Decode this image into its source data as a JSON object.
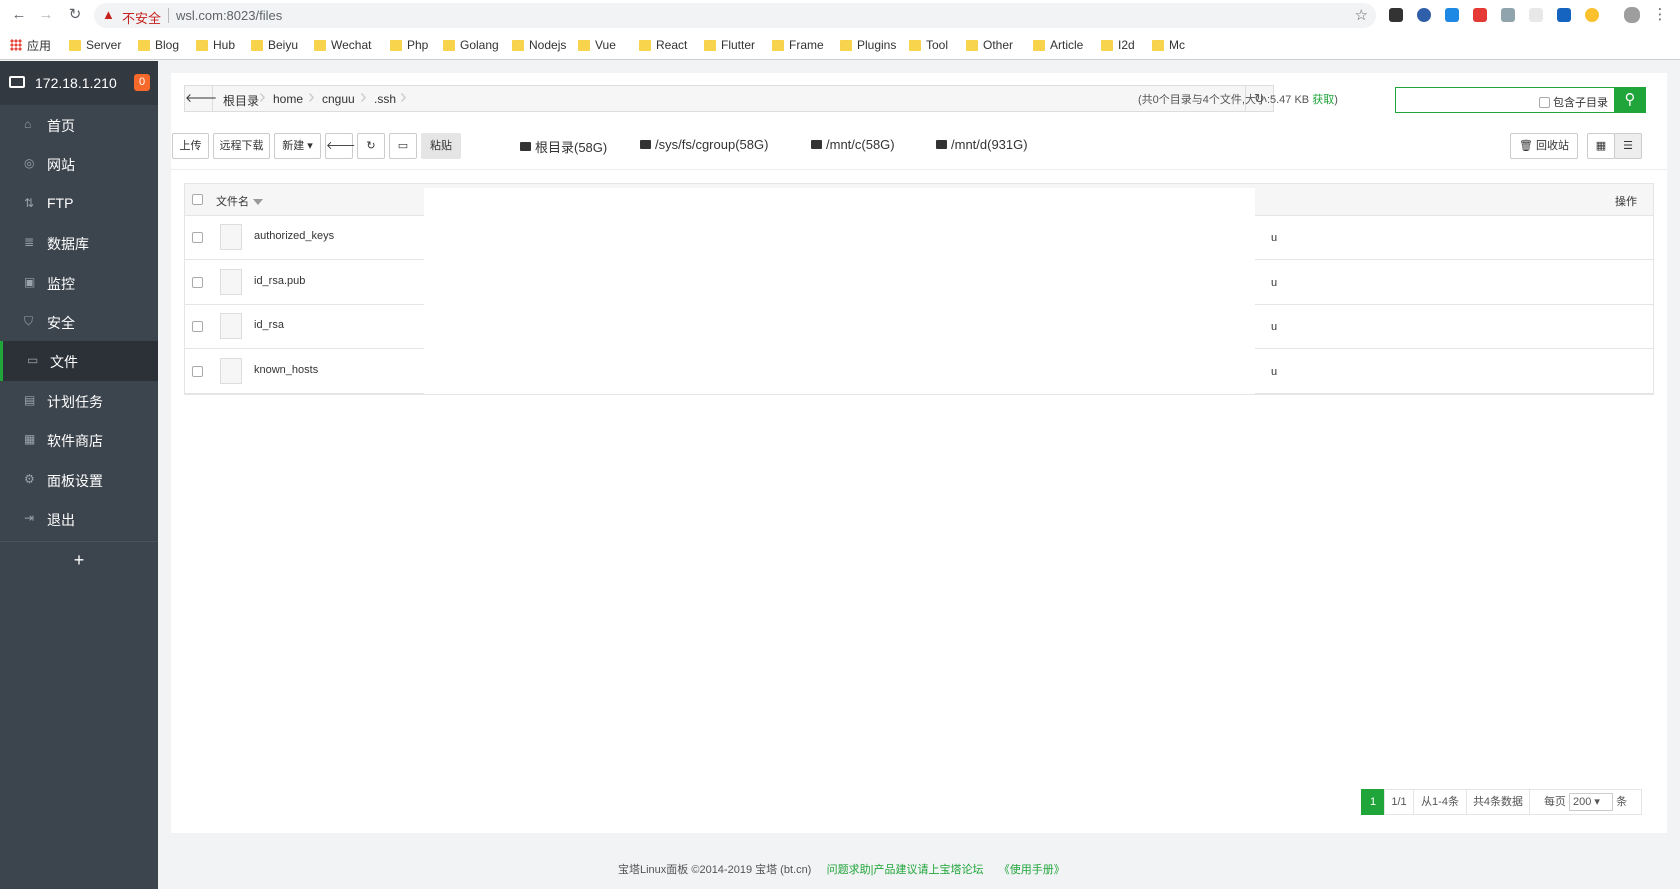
{
  "browser": {
    "insecure_label": "不安全",
    "url": "wsl.com:8023/files"
  },
  "bookmarks": [
    "应用",
    "Server",
    "Blog",
    "Hub",
    "Beiyu",
    "Wechat",
    "Php",
    "Golang",
    "Nodejs",
    "Vue",
    "React",
    "Flutter",
    "Frame",
    "Plugins",
    "Tool",
    "Other",
    "Article",
    "I2d",
    "Mc"
  ],
  "sidebar": {
    "ip": "172.18.1.210",
    "badge": "0",
    "items": [
      {
        "label": "首页",
        "icon": "home-icon"
      },
      {
        "label": "网站",
        "icon": "globe-icon"
      },
      {
        "label": "FTP",
        "icon": "ftp-icon"
      },
      {
        "label": "数据库",
        "icon": "database-icon"
      },
      {
        "label": "监控",
        "icon": "monitor-icon"
      },
      {
        "label": "安全",
        "icon": "shield-icon"
      },
      {
        "label": "文件",
        "icon": "folder-icon"
      },
      {
        "label": "计划任务",
        "icon": "calendar-icon"
      },
      {
        "label": "软件商店",
        "icon": "grid-icon"
      },
      {
        "label": "面板设置",
        "icon": "gear-icon"
      },
      {
        "label": "退出",
        "icon": "logout-icon"
      }
    ],
    "add": "+"
  },
  "breadcrumb": [
    "根目录",
    "home",
    "cnguu",
    ".ssh"
  ],
  "dir_info": {
    "text": "(共0个目录与4个文件,大小:5.47 KB",
    "fetch": "获取",
    "close": ")"
  },
  "search": {
    "subdir_label": "包含子目录"
  },
  "toolbar": {
    "upload": "上传",
    "remote_download": "远程下载",
    "new": "新建",
    "paste": "粘贴",
    "disks": [
      "根目录(58G)",
      "/sys/fs/cgroup(58G)",
      "/mnt/c(58G)",
      "/mnt/d(931G)"
    ],
    "recycle": "回收站"
  },
  "table": {
    "col_name": "文件名",
    "col_op": "操作",
    "rows": [
      {
        "name": "authorized_keys",
        "owner": "u"
      },
      {
        "name": "id_rsa.pub",
        "owner": "u"
      },
      {
        "name": "id_rsa",
        "owner": "u"
      },
      {
        "name": "known_hosts",
        "owner": "u"
      }
    ]
  },
  "pager": {
    "current": "1",
    "pages": "1/1",
    "range": "从1-4条",
    "total": "共4条数据",
    "per_page_label": "每页",
    "per_page": "200",
    "unit": "条"
  },
  "footer": {
    "copyright": "宝塔Linux面板 ©2014-2019 宝塔 (bt.cn)",
    "help": "问题求助|产品建议请上宝塔论坛",
    "manual": "《使用手册》"
  },
  "colors": {
    "accent": "#20a53a",
    "sidebar": "#3c444d",
    "badge": "#f7692a"
  }
}
